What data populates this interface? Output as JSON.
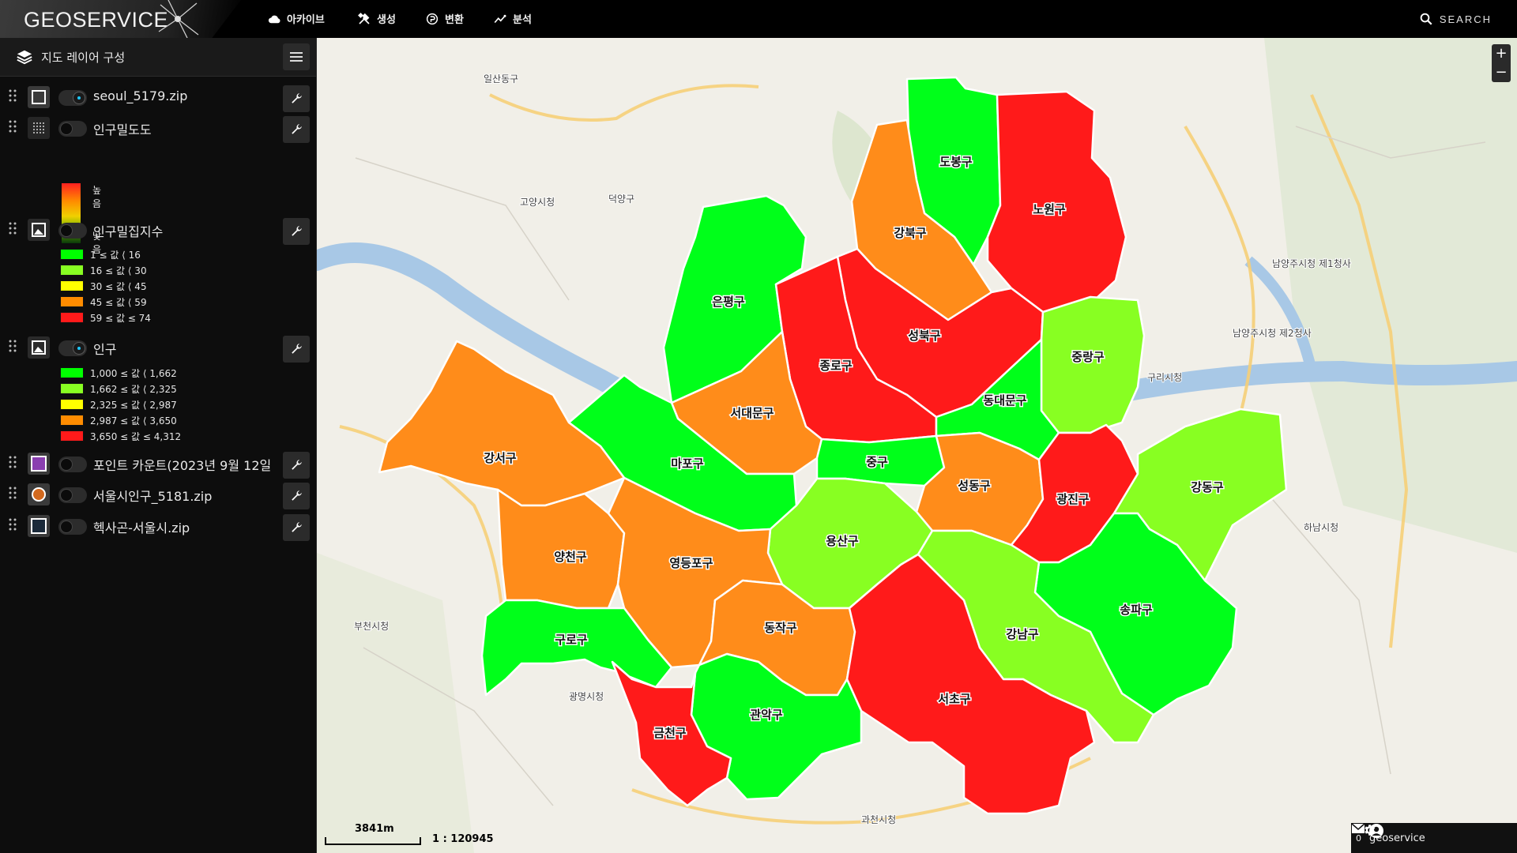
{
  "app": {
    "title": "GEOSERVICE"
  },
  "nav": [
    {
      "label": "아카이브",
      "icon": "cloud-icon"
    },
    {
      "label": "생성",
      "icon": "tools-icon"
    },
    {
      "label": "변환",
      "icon": "convert-icon"
    },
    {
      "label": "분석",
      "icon": "analysis-icon"
    }
  ],
  "search": {
    "label": "SEARCH"
  },
  "panel": {
    "title": "지도 레이어 구성"
  },
  "layers": [
    {
      "name": "seoul_5179.zip",
      "symbol": "square-outline",
      "visible": true
    },
    {
      "name": "인구밀도도",
      "symbol": "grid",
      "visible": false,
      "legend": {
        "high": "높음",
        "low": "낮음"
      }
    },
    {
      "name": "인구밀집지수",
      "symbol": "image",
      "visible": false,
      "classes": [
        {
          "color": "#00ff00",
          "label": "1 ≤ 값 ⟨ 16"
        },
        {
          "color": "#88ff22",
          "label": "16 ≤ 값 ⟨ 30"
        },
        {
          "color": "#ffff00",
          "label": "30 ≤ 값 ⟨ 45"
        },
        {
          "color": "#ff8c00",
          "label": "45 ≤ 값 ⟨ 59"
        },
        {
          "color": "#ff1a1a",
          "label": "59 ≤ 값 ≤ 74"
        }
      ]
    },
    {
      "name": "인구",
      "symbol": "image",
      "visible": true,
      "classes": [
        {
          "color": "#00ff00",
          "label": "1,000 ≤ 값 ⟨ 1,662"
        },
        {
          "color": "#88ff22",
          "label": "1,662 ≤ 값 ⟨ 2,325"
        },
        {
          "color": "#ffff00",
          "label": "2,325 ≤ 값 ⟨ 2,987"
        },
        {
          "color": "#ff8c00",
          "label": "2,987 ≤ 값 ⟨ 3,650"
        },
        {
          "color": "#ff1a1a",
          "label": "3,650 ≤ 값 ≤ 4,312"
        }
      ]
    },
    {
      "name": "포인트 카운트(2023년 9월 12일",
      "symbol": "purple-square",
      "visible": false
    },
    {
      "name": "서울시인구_5181.zip",
      "symbol": "orange-circle",
      "visible": false
    },
    {
      "name": "헥사곤-서울시.zip",
      "symbol": "square-outline",
      "visible": false
    }
  ],
  "colors": {
    "red": "#ff1a1a",
    "orange": "#ff8c1a",
    "green": "#00ff1a",
    "lime": "#88ff22"
  },
  "districts": [
    {
      "name": "도봉구",
      "class": "green"
    },
    {
      "name": "노원구",
      "class": "red"
    },
    {
      "name": "강북구",
      "class": "orange"
    },
    {
      "name": "은평구",
      "class": "green"
    },
    {
      "name": "성북구",
      "class": "red"
    },
    {
      "name": "종로구",
      "class": "red"
    },
    {
      "name": "중랑구",
      "class": "lime"
    },
    {
      "name": "동대문구",
      "class": "green"
    },
    {
      "name": "서대문구",
      "class": "orange"
    },
    {
      "name": "마포구",
      "class": "green"
    },
    {
      "name": "중구",
      "class": "green"
    },
    {
      "name": "강서구",
      "class": "orange"
    },
    {
      "name": "성동구",
      "class": "orange"
    },
    {
      "name": "광진구",
      "class": "red"
    },
    {
      "name": "강동구",
      "class": "lime"
    },
    {
      "name": "용산구",
      "class": "lime"
    },
    {
      "name": "양천구",
      "class": "orange"
    },
    {
      "name": "영등포구",
      "class": "orange"
    },
    {
      "name": "송파구",
      "class": "green"
    },
    {
      "name": "동작구",
      "class": "orange"
    },
    {
      "name": "구로구",
      "class": "green"
    },
    {
      "name": "강남구",
      "class": "lime"
    },
    {
      "name": "서초구",
      "class": "red"
    },
    {
      "name": "관악구",
      "class": "green"
    },
    {
      "name": "금천구",
      "class": "red"
    }
  ],
  "map_labels": [
    "고양시청",
    "남양주시청 제1청사",
    "남양주시청 제2청사",
    "구리시청",
    "하남시청",
    "부천시청",
    "광명시청",
    "과천시청",
    "일산동구",
    "덕양구"
  ],
  "scale": {
    "distance": "3841m",
    "ratio": "1 : 120945"
  },
  "status": {
    "messages": "0",
    "user": "geoservice"
  }
}
